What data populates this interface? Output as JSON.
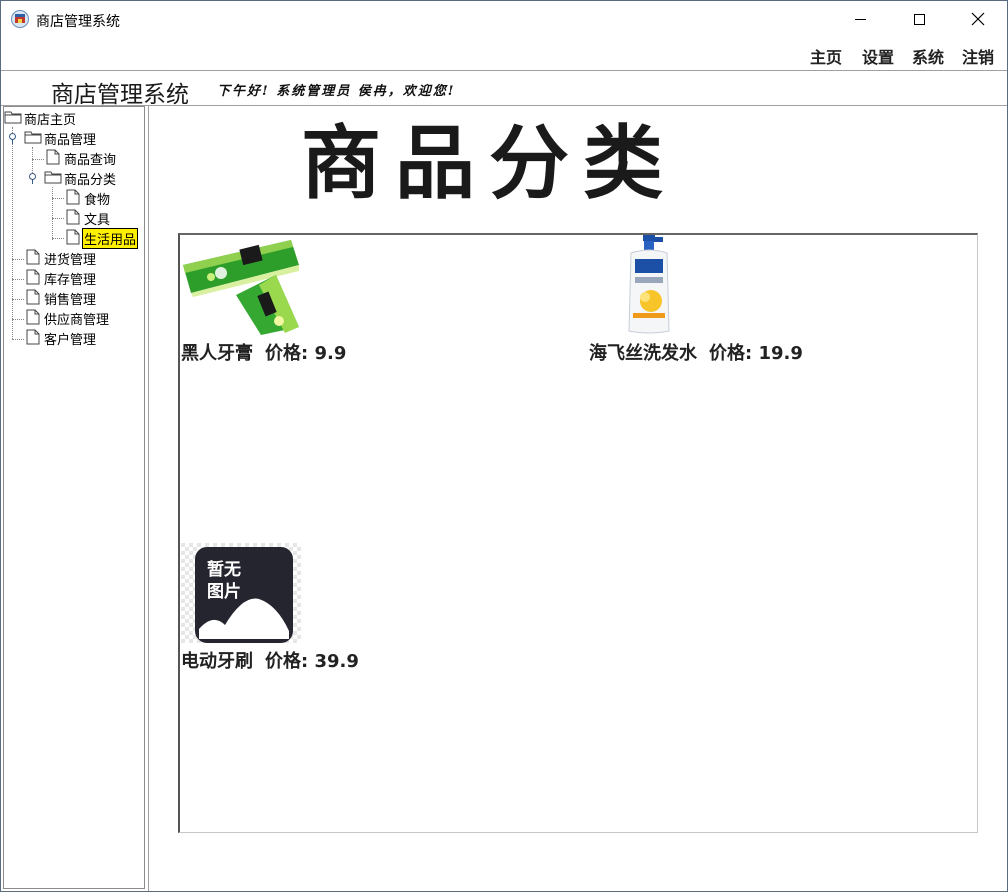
{
  "window": {
    "title": "商店管理系统"
  },
  "menu": {
    "items": [
      "主页",
      "设置",
      "系统",
      "注销"
    ]
  },
  "banner": {
    "title": "商店管理系统",
    "greeting": "下午好! 系统管理员 侯冉，欢迎您!"
  },
  "tree": {
    "root": "商店主页",
    "goods_mgmt": "商品管理",
    "goods_query": "商品查询",
    "goods_category": "商品分类",
    "cat_food": "食物",
    "cat_stationery": "文具",
    "cat_daily": "生活用品",
    "purchase_mgmt": "进货管理",
    "stock_mgmt": "库存管理",
    "sales_mgmt": "销售管理",
    "supplier_mgmt": "供应商管理",
    "customer_mgmt": "客户管理"
  },
  "content": {
    "title": "商品分类",
    "products": [
      {
        "name": "黑人牙膏",
        "price_label": "价格: 9.9",
        "image": "toothpaste"
      },
      {
        "name": "海飞丝洗发水",
        "price_label": "价格: 19.9",
        "image": "shampoo-bottle"
      },
      {
        "name": "电动牙刷",
        "price_label": "价格: 39.9",
        "image": "no-image-placeholder",
        "placeholder_text": [
          "暂无",
          "图片"
        ]
      }
    ]
  },
  "colors": {
    "selection": "#ffef00",
    "text": "#222222"
  }
}
